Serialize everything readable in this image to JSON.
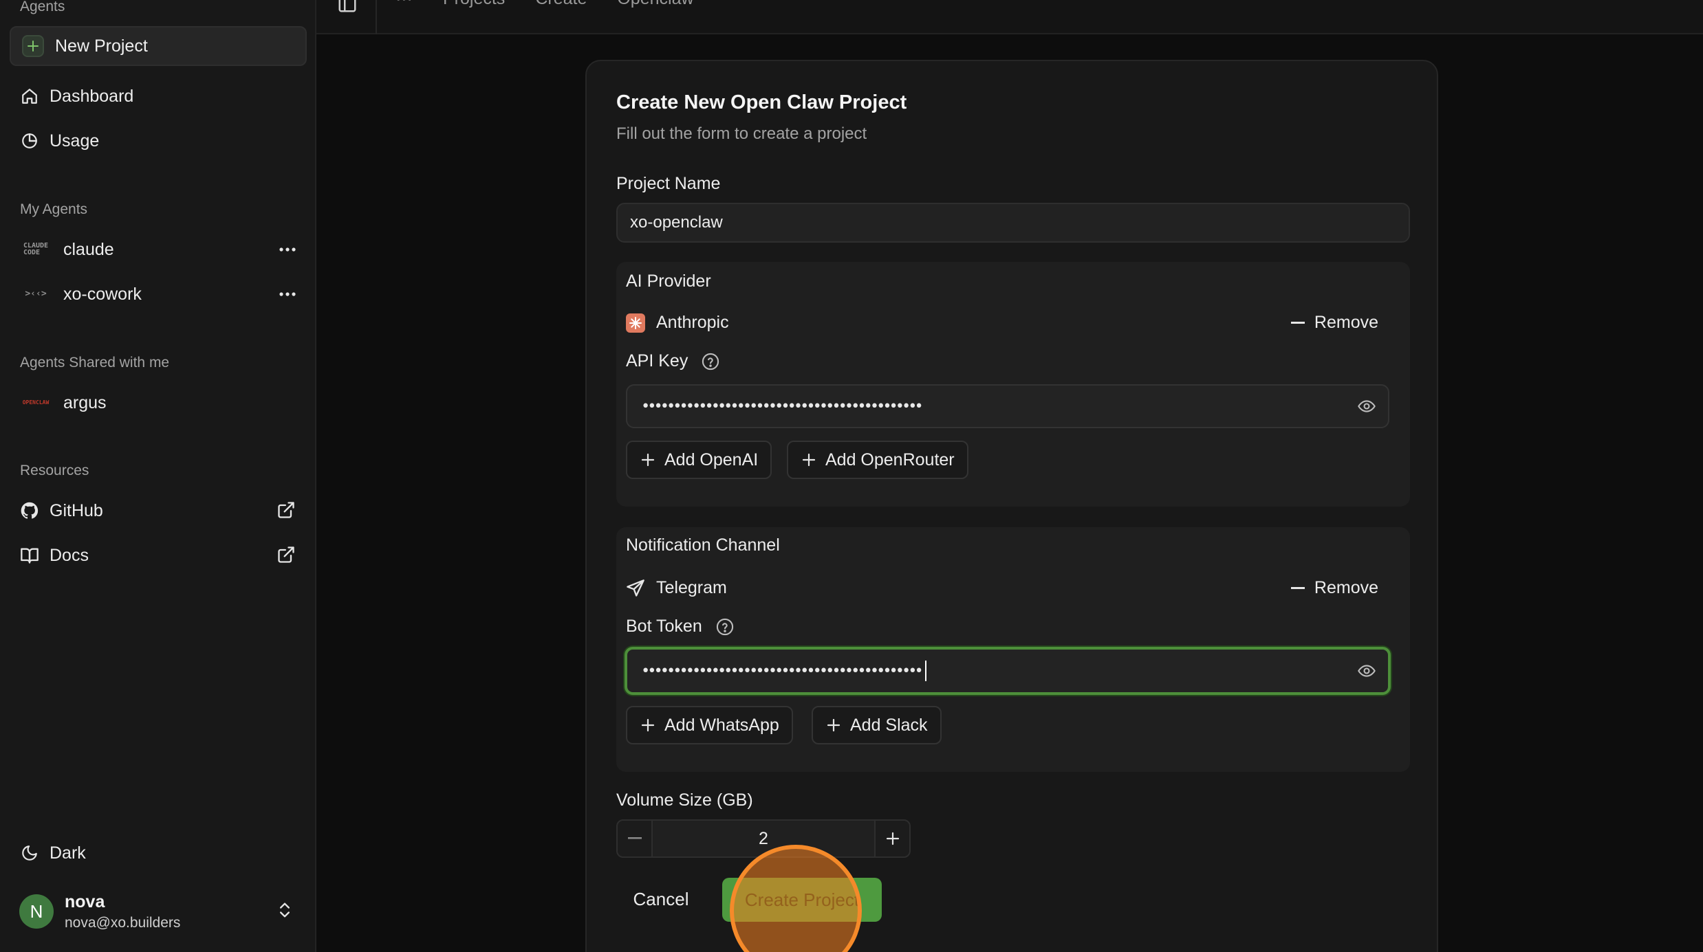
{
  "sidebar": {
    "agents_label": "Agents",
    "new_project": "New Project",
    "nav": [
      {
        "label": "Dashboard",
        "icon": "home-icon"
      },
      {
        "label": "Usage",
        "icon": "pie-chart-icon"
      }
    ],
    "my_agents_label": "My Agents",
    "my_agents": [
      {
        "label": "claude",
        "logo": "CLAUDE CODE"
      },
      {
        "label": "xo-cowork",
        "logo": ">‹‹>"
      }
    ],
    "shared_label": "Agents Shared with me",
    "shared_agents": [
      {
        "label": "argus",
        "logo": "OPENCLAW"
      }
    ],
    "resources_label": "Resources",
    "resources": [
      {
        "label": "GitHub",
        "icon": "github-icon"
      },
      {
        "label": "Docs",
        "icon": "book-icon"
      }
    ],
    "theme": "Dark",
    "user": {
      "initial": "N",
      "name": "nova",
      "email": "nova@xo.builders"
    }
  },
  "topbar": {
    "breadcrumbs": [
      "⋯",
      "Projects",
      "Create",
      "Openclaw"
    ]
  },
  "form": {
    "title": "Create New Open Claw Project",
    "subtitle": "Fill out the form to create a project",
    "project_name_label": "Project Name",
    "project_name_value": "xo-openclaw",
    "ai_provider": {
      "title": "AI Provider",
      "provider": "Anthropic",
      "remove": "Remove",
      "key_label": "API Key",
      "key_dots": "••••••••••••••••••••••••••••••••••••••••••••",
      "add_buttons": [
        "Add OpenAI",
        "Add OpenRouter"
      ]
    },
    "notification": {
      "title": "Notification Channel",
      "channel": "Telegram",
      "remove": "Remove",
      "token_label": "Bot Token",
      "token_dots": "••••••••••••••••••••••••••••••••••••••••••••",
      "add_buttons": [
        "Add WhatsApp",
        "Add Slack"
      ]
    },
    "volume_label": "Volume Size (GB)",
    "volume_value": "2",
    "cancel": "Cancel",
    "create": "Create Project"
  },
  "colors": {
    "accent_green": "#4e9a3f",
    "focus_ring": "#4d8f3a",
    "click_indicator": "#f58a2a",
    "anthropic_brand": "#e07a5f"
  }
}
